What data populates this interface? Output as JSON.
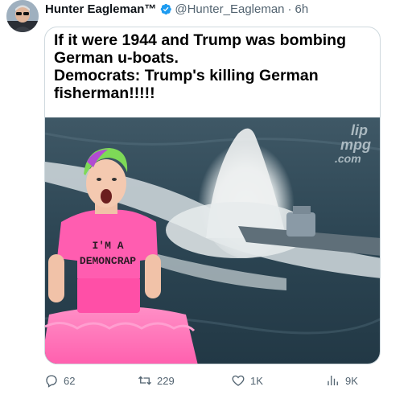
{
  "tweet": {
    "display_name": "Hunter Eagleman™",
    "handle": "@Hunter_Eagleman",
    "separator": "·",
    "time": "6h",
    "verified_icon": "verified-badge-icon",
    "avatar_icon": "avatar"
  },
  "media": {
    "caption_lines": [
      "If it were 1944 and Trump was bombing",
      "German u-boats.",
      "Democrats: Trump's killing German",
      "fisherman!!!!!"
    ],
    "watermark": [
      "lip",
      "mpg",
      ".com"
    ],
    "shirt_text": [
      "I'M A",
      "DEMONCRAP"
    ]
  },
  "actions": {
    "reply": {
      "icon": "reply-icon",
      "count": "62"
    },
    "retweet": {
      "icon": "retweet-icon",
      "count": "229"
    },
    "like": {
      "icon": "heart-icon",
      "count": "1K"
    },
    "views": {
      "icon": "views-icon",
      "count": "9K"
    }
  },
  "colors": {
    "accent": "#1d9bf0",
    "muted": "#536471",
    "border": "#cfd9de"
  }
}
